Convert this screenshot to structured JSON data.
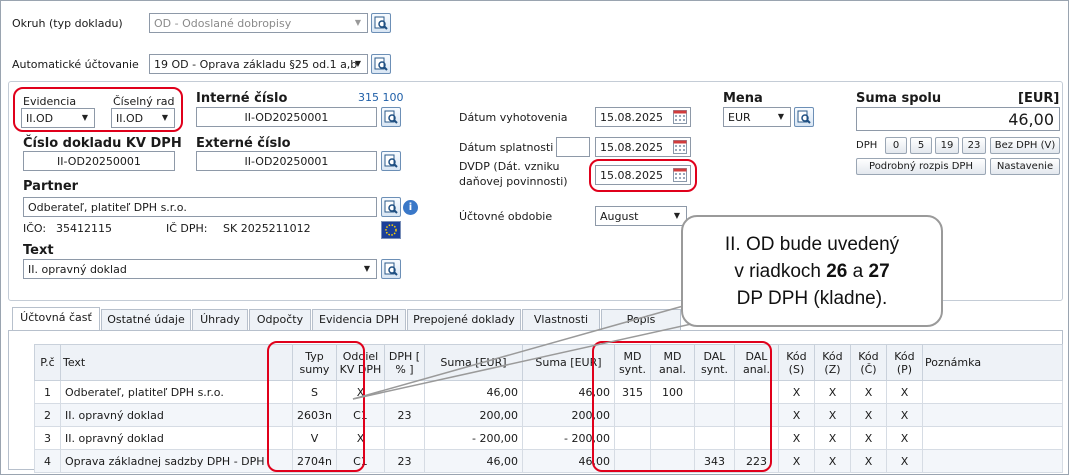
{
  "header": {
    "okruh_label": "Okruh (typ dokladu)",
    "okruh_value": "OD - Odoslané dobropisy",
    "auto_label": "Automatické účtovanie",
    "auto_value": "19 OD - Oprava základu §25 od.1 a,b"
  },
  "left": {
    "evidencia_label": "Evidencia",
    "evidencia_value": "II.OD",
    "rad_label": "Číselný rad",
    "rad_value": "II.OD",
    "interne_label": "Interné číslo",
    "interne_counts": "315 100",
    "interne_value": "II-OD20250001",
    "kv_label": "Číslo dokladu KV DPH",
    "kv_value": "II-OD20250001",
    "externe_label": "Externé číslo",
    "externe_value": "II-OD20250001",
    "partner_label": "Partner",
    "partner_value": "Odberateľ, platiteľ DPH s.r.o.",
    "ico_label": "IČO:",
    "ico_value": "35412115",
    "icdph_label": "IČ DPH:",
    "icdph_value": "SK 2025211012",
    "text_label": "Text",
    "text_value": "II. opravný doklad"
  },
  "dates": {
    "vyhotovenia_label": "Dátum vyhotovenia",
    "vyhotovenia_value": "15.08.2025",
    "splatnosti_label": "Dátum splatnosti",
    "splatnosti_value": "15.08.2025",
    "dvdp_label_1": "DVDP (Dát. vzniku",
    "dvdp_label_2": "daňovej povinnosti)",
    "dvdp_value": "15.08.2025",
    "obdobie_label": "Účtovné obdobie",
    "obdobie_value": "August"
  },
  "mena": {
    "label": "Mena",
    "value": "EUR"
  },
  "suma": {
    "label": "Suma spolu",
    "currency": "[EUR]",
    "value": "46,00",
    "dph_label": "DPH",
    "rates": [
      "0",
      "5",
      "19",
      "23"
    ],
    "bez_dph": "Bez DPH (V)",
    "rozpis": "Podrobný rozpis DPH",
    "nastavenie": "Nastavenie"
  },
  "tabs": [
    "Účtovná časť",
    "Ostatné údaje",
    "Úhrady",
    "Odpočty",
    "Evidencia DPH",
    "Prepojené doklady",
    "Vlastnosti",
    "Popis"
  ],
  "table": {
    "headers": [
      "P.č",
      "Text",
      "Typ sumy",
      "Oddiel KV DPH",
      "DPH [ % ]",
      "Suma [EUR]",
      "Suma [EUR]",
      "MD synt.",
      "MD anal.",
      "DAL synt.",
      "DAL anal.",
      "Kód (S)",
      "Kód (Z)",
      "Kód (Č)",
      "Kód (P)",
      "Poznámka"
    ],
    "rows": [
      [
        "1",
        "Odberateľ, platiteľ DPH s.r.o.",
        "S",
        "X",
        "",
        "46,00",
        "46,00",
        "315",
        "100",
        "",
        "",
        "X",
        "X",
        "X",
        "X",
        ""
      ],
      [
        "2",
        "II. opravný doklad",
        "2603n",
        "C1",
        "23",
        "200,00",
        "200,00",
        "",
        "",
        "",
        "",
        "X",
        "X",
        "X",
        "X",
        ""
      ],
      [
        "3",
        "II. opravný doklad",
        "V",
        "X",
        "",
        "- 200,00",
        "- 200,00",
        "",
        "",
        "",
        "",
        "X",
        "X",
        "X",
        "X",
        ""
      ],
      [
        "4",
        "Oprava základnej sadzby DPH - DPH",
        "2704n",
        "C1",
        "23",
        "46,00",
        "46,00",
        "",
        "",
        "343",
        "223",
        "X",
        "X",
        "X",
        "X",
        ""
      ]
    ]
  },
  "callout": {
    "line1": "II. OD bude uvedený",
    "line2_a": "v riadkoch ",
    "line2_b": "26",
    "line2_c": " a ",
    "line2_d": "27",
    "line3": "DP DPH (kladne)."
  },
  "colors": {
    "highlight": "#e0001b",
    "accent": "#1f5fa8"
  }
}
